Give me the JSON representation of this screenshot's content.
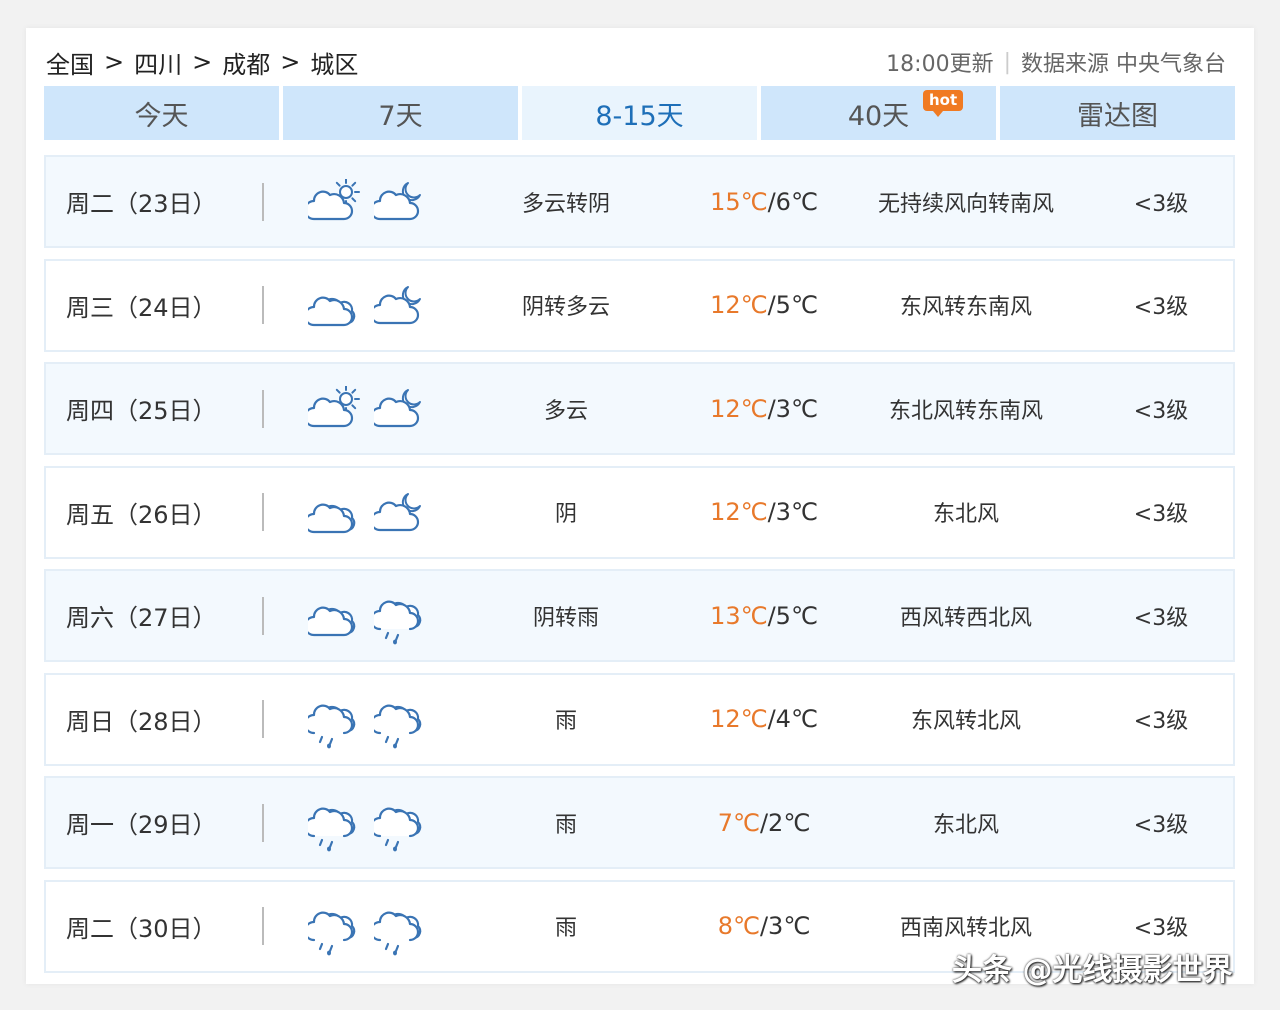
{
  "breadcrumb": [
    "全国",
    "四川",
    "成都",
    "城区"
  ],
  "breadcrumb_sep": ">",
  "meta": {
    "update": "18:00更新",
    "divider": "|",
    "source": "数据来源 中央气象台"
  },
  "tabs": [
    {
      "label": "今天",
      "active": false
    },
    {
      "label": "7天",
      "active": false
    },
    {
      "label": "8-15天",
      "active": true
    },
    {
      "label": "40天",
      "active": false,
      "badge": "hot"
    },
    {
      "label": "雷达图",
      "active": false
    }
  ],
  "colors": {
    "accent": "#1e6fb8",
    "tab_bg": "#cfe6fb",
    "hot_badge": "#f07a22",
    "high_temp": "#e8792b",
    "icon_stroke": "#3a74b4"
  },
  "forecast": [
    {
      "date": "周二（23日）",
      "icons": [
        "partly-cloudy-day-icon",
        "partly-cloudy-night-icon"
      ],
      "desc": "多云转阴",
      "high": "15℃",
      "low": "6℃",
      "wind": "无持续风向转南风",
      "level": "<3级"
    },
    {
      "date": "周三（24日）",
      "icons": [
        "cloudy-icon",
        "partly-cloudy-night-icon"
      ],
      "desc": "阴转多云",
      "high": "12℃",
      "low": "5℃",
      "wind": "东风转东南风",
      "level": "<3级"
    },
    {
      "date": "周四（25日）",
      "icons": [
        "partly-cloudy-day-icon",
        "partly-cloudy-night-icon"
      ],
      "desc": "多云",
      "high": "12℃",
      "low": "3℃",
      "wind": "东北风转东南风",
      "level": "<3级"
    },
    {
      "date": "周五（26日）",
      "icons": [
        "cloudy-icon",
        "partly-cloudy-night-icon"
      ],
      "desc": "阴",
      "high": "12℃",
      "low": "3℃",
      "wind": "东北风",
      "level": "<3级"
    },
    {
      "date": "周六（27日）",
      "icons": [
        "cloudy-icon",
        "rain-icon"
      ],
      "desc": "阴转雨",
      "high": "13℃",
      "low": "5℃",
      "wind": "西风转西北风",
      "level": "<3级"
    },
    {
      "date": "周日（28日）",
      "icons": [
        "rain-icon",
        "rain-icon"
      ],
      "desc": "雨",
      "high": "12℃",
      "low": "4℃",
      "wind": "东风转北风",
      "level": "<3级"
    },
    {
      "date": "周一（29日）",
      "icons": [
        "rain-icon",
        "rain-icon"
      ],
      "desc": "雨",
      "high": "7℃",
      "low": "2℃",
      "wind": "东北风",
      "level": "<3级"
    },
    {
      "date": "周二（30日）",
      "icons": [
        "rain-icon",
        "rain-icon"
      ],
      "desc": "雨",
      "high": "8℃",
      "low": "3℃",
      "wind": "西南风转北风",
      "level": "<3级"
    }
  ],
  "temp_sep": "/",
  "watermark": "头条 @光线摄影世界"
}
